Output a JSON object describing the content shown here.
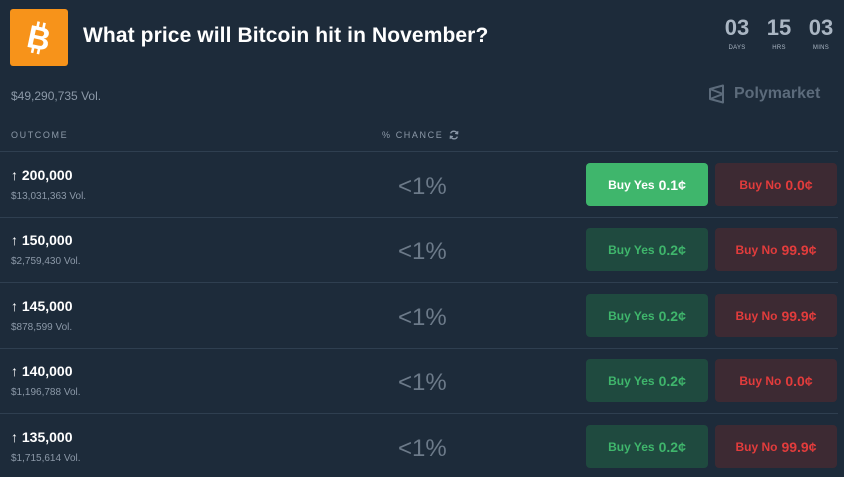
{
  "header": {
    "title": "What price will Bitcoin hit in November?",
    "logo_icon": "bitcoin-icon",
    "logo_color": "#f7931a",
    "volume": "$49,290,735 Vol.",
    "brand": "Polymarket"
  },
  "countdown": {
    "days": "03",
    "days_label": "DAYS",
    "hrs": "15",
    "hrs_label": "HRS",
    "mins": "03",
    "mins_label": "MINS"
  },
  "table": {
    "col_outcome": "OUTCOME",
    "col_chance": "% CHANCE",
    "rows": [
      {
        "name": "↑ 200,000",
        "volume": "$13,031,363 Vol.",
        "chance": "<1%",
        "yes_label": "Buy Yes",
        "yes_price": "0.1¢",
        "no_label": "Buy No",
        "no_price": "0.0¢"
      },
      {
        "name": "↑ 150,000",
        "volume": "$2,759,430 Vol.",
        "chance": "<1%",
        "yes_label": "Buy Yes",
        "yes_price": "0.2¢",
        "no_label": "Buy No",
        "no_price": "99.9¢"
      },
      {
        "name": "↑ 145,000",
        "volume": "$878,599 Vol.",
        "chance": "<1%",
        "yes_label": "Buy Yes",
        "yes_price": "0.2¢",
        "no_label": "Buy No",
        "no_price": "99.9¢"
      },
      {
        "name": "↑ 140,000",
        "volume": "$1,196,788 Vol.",
        "chance": "<1%",
        "yes_label": "Buy Yes",
        "yes_price": "0.2¢",
        "no_label": "Buy No",
        "no_price": "0.0¢"
      },
      {
        "name": "↑ 135,000",
        "volume": "$1,715,614 Vol.",
        "chance": "<1%",
        "yes_label": "Buy Yes",
        "yes_price": "0.2¢",
        "no_label": "Buy No",
        "no_price": "99.9¢"
      }
    ]
  },
  "colors": {
    "background": "#1d2b3a",
    "yes_green": "#3fb66c",
    "no_red": "#e23c3c"
  }
}
